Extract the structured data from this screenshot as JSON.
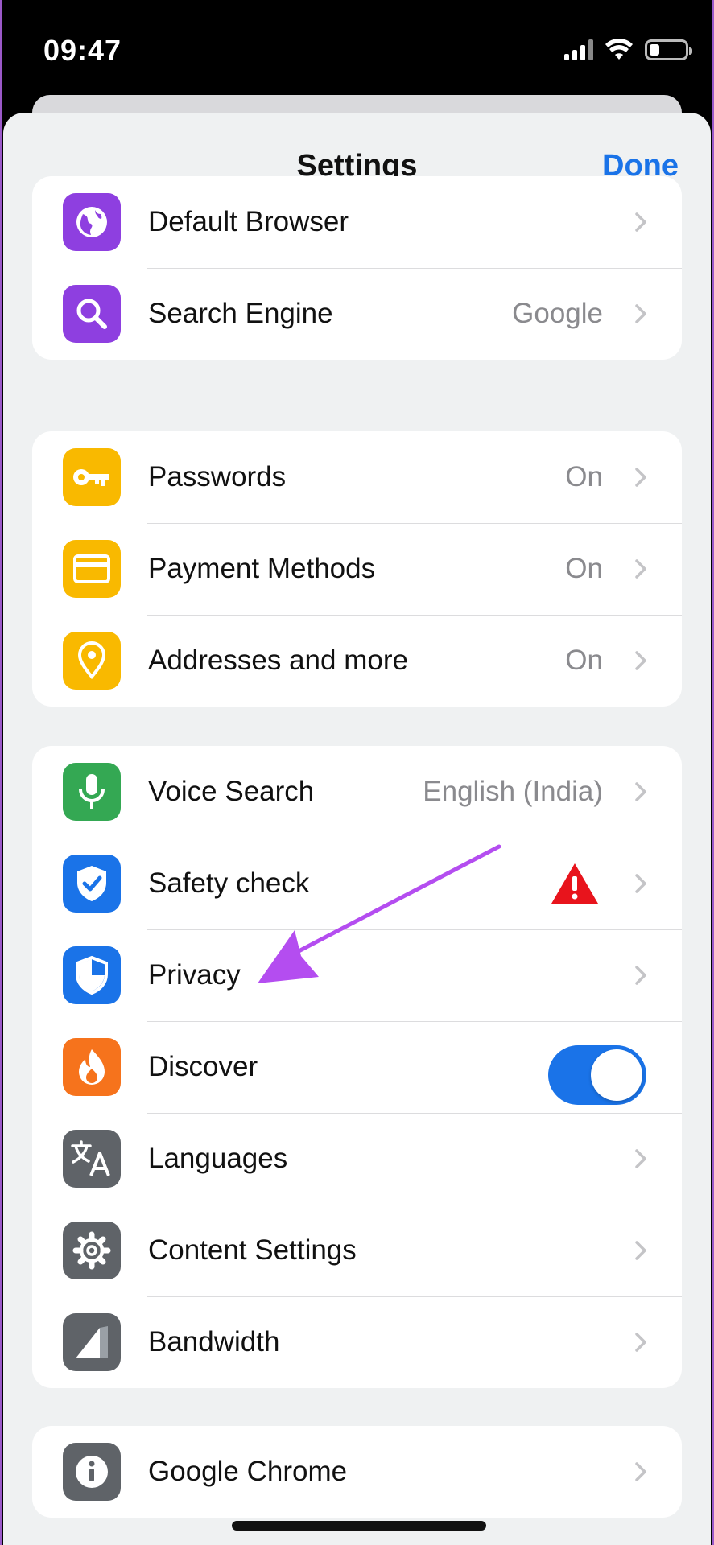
{
  "status_bar": {
    "time": "09:47"
  },
  "header": {
    "title": "Settings",
    "done_label": "Done"
  },
  "groups": [
    {
      "items": [
        {
          "label": "Default Browser",
          "value": "",
          "icon": "globe-icon",
          "color": "#8e3fe0"
        },
        {
          "label": "Search Engine",
          "value": "Google",
          "icon": "search-icon",
          "color": "#8e3fe0"
        }
      ]
    },
    {
      "items": [
        {
          "label": "Passwords",
          "value": "On",
          "icon": "key-icon",
          "color": "#f9b900"
        },
        {
          "label": "Payment Methods",
          "value": "On",
          "icon": "credit-card-icon",
          "color": "#f9b900"
        },
        {
          "label": "Addresses and more",
          "value": "On",
          "icon": "location-pin-icon",
          "color": "#f9b900"
        }
      ]
    },
    {
      "items": [
        {
          "label": "Voice Search",
          "value": "English (India)",
          "icon": "microphone-icon",
          "color": "#34a853"
        },
        {
          "label": "Safety check",
          "value": "",
          "icon": "shield-check-icon",
          "color": "#1a73e8"
        },
        {
          "label": "Privacy",
          "value": "",
          "icon": "shield-privacy-icon",
          "color": "#1a73e8"
        },
        {
          "label": "Discover",
          "value": "",
          "icon": "flame-icon",
          "color": "#f6731c",
          "toggle_on": true
        },
        {
          "label": "Languages",
          "value": "",
          "icon": "translate-icon",
          "color": "#5f6368"
        },
        {
          "label": "Content Settings",
          "value": "",
          "icon": "gear-icon",
          "color": "#5f6368"
        },
        {
          "label": "Bandwidth",
          "value": "",
          "icon": "signal-bandwidth-icon",
          "color": "#5f6368"
        }
      ]
    },
    {
      "items": [
        {
          "label": "Google Chrome",
          "value": "",
          "icon": "info-icon",
          "color": "#5f6368"
        }
      ]
    }
  ],
  "colors": {
    "accent": "#1a73e8",
    "warning": "#e8141c",
    "annotation_arrow": "#b44df0"
  }
}
